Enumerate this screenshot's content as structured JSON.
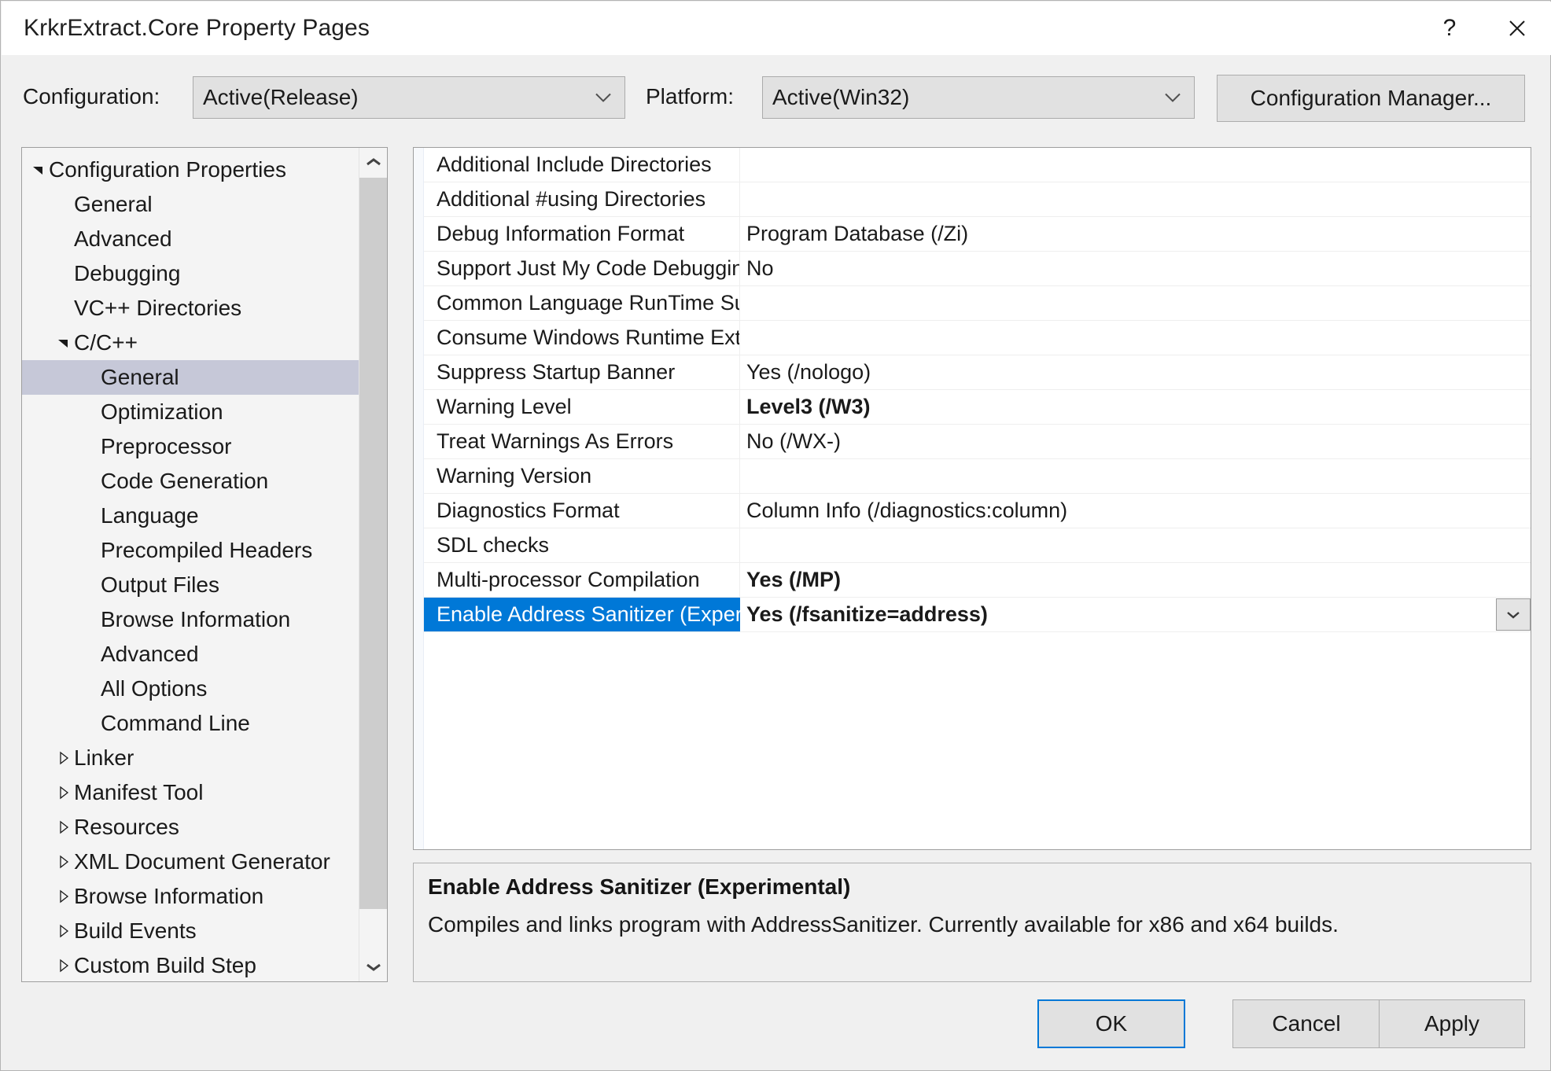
{
  "window": {
    "title": "KrkrExtract.Core Property Pages",
    "help_button": "?",
    "close_button": "✕",
    "help_icon": "question-mark-icon",
    "close_icon": "close-icon"
  },
  "toolbar": {
    "configuration_label": "Configuration:",
    "configuration_value": "Active(Release)",
    "platform_label": "Platform:",
    "platform_value": "Active(Win32)",
    "configuration_manager_label": "Configuration Manager..."
  },
  "tree": {
    "items": [
      {
        "label": "Configuration Properties",
        "depth": 1,
        "state": "expanded",
        "selected": false
      },
      {
        "label": "General",
        "depth": 2,
        "state": "leaf",
        "selected": false
      },
      {
        "label": "Advanced",
        "depth": 2,
        "state": "leaf",
        "selected": false
      },
      {
        "label": "Debugging",
        "depth": 2,
        "state": "leaf",
        "selected": false
      },
      {
        "label": "VC++ Directories",
        "depth": 2,
        "state": "leaf",
        "selected": false
      },
      {
        "label": "C/C++",
        "depth": 2,
        "state": "expanded",
        "selected": false
      },
      {
        "label": "General",
        "depth": 3,
        "state": "leaf",
        "selected": true
      },
      {
        "label": "Optimization",
        "depth": 3,
        "state": "leaf",
        "selected": false
      },
      {
        "label": "Preprocessor",
        "depth": 3,
        "state": "leaf",
        "selected": false
      },
      {
        "label": "Code Generation",
        "depth": 3,
        "state": "leaf",
        "selected": false
      },
      {
        "label": "Language",
        "depth": 3,
        "state": "leaf",
        "selected": false
      },
      {
        "label": "Precompiled Headers",
        "depth": 3,
        "state": "leaf",
        "selected": false
      },
      {
        "label": "Output Files",
        "depth": 3,
        "state": "leaf",
        "selected": false
      },
      {
        "label": "Browse Information",
        "depth": 3,
        "state": "leaf",
        "selected": false
      },
      {
        "label": "Advanced",
        "depth": 3,
        "state": "leaf",
        "selected": false
      },
      {
        "label": "All Options",
        "depth": 3,
        "state": "leaf",
        "selected": false
      },
      {
        "label": "Command Line",
        "depth": 3,
        "state": "leaf",
        "selected": false
      },
      {
        "label": "Linker",
        "depth": 2,
        "state": "collapsed",
        "selected": false
      },
      {
        "label": "Manifest Tool",
        "depth": 2,
        "state": "collapsed",
        "selected": false
      },
      {
        "label": "Resources",
        "depth": 2,
        "state": "collapsed",
        "selected": false
      },
      {
        "label": "XML Document Generator",
        "depth": 2,
        "state": "collapsed",
        "selected": false
      },
      {
        "label": "Browse Information",
        "depth": 2,
        "state": "collapsed",
        "selected": false
      },
      {
        "label": "Build Events",
        "depth": 2,
        "state": "collapsed",
        "selected": false
      },
      {
        "label": "Custom Build Step",
        "depth": 2,
        "state": "collapsed",
        "selected": false
      }
    ],
    "scrollbar": {
      "up_icon": "chevron-up-icon",
      "down_icon": "chevron-down-icon"
    }
  },
  "property_grid": {
    "rows": [
      {
        "name": "Additional Include Directories",
        "value": "",
        "modified": false,
        "selected": false
      },
      {
        "name": "Additional #using Directories",
        "value": "",
        "modified": false,
        "selected": false
      },
      {
        "name": "Debug Information Format",
        "value": "Program Database (/Zi)",
        "modified": false,
        "selected": false
      },
      {
        "name": "Support Just My Code Debugging",
        "value": "No",
        "modified": false,
        "selected": false
      },
      {
        "name": "Common Language RunTime Support",
        "value": "",
        "modified": false,
        "selected": false
      },
      {
        "name": "Consume Windows Runtime Extension",
        "value": "",
        "modified": false,
        "selected": false
      },
      {
        "name": "Suppress Startup Banner",
        "value": "Yes (/nologo)",
        "modified": false,
        "selected": false
      },
      {
        "name": "Warning Level",
        "value": "Level3 (/W3)",
        "modified": true,
        "selected": false
      },
      {
        "name": "Treat Warnings As Errors",
        "value": "No (/WX-)",
        "modified": false,
        "selected": false
      },
      {
        "name": "Warning Version",
        "value": "",
        "modified": false,
        "selected": false
      },
      {
        "name": "Diagnostics Format",
        "value": "Column Info (/diagnostics:column)",
        "modified": false,
        "selected": false
      },
      {
        "name": "SDL checks",
        "value": "",
        "modified": false,
        "selected": false
      },
      {
        "name": "Multi-processor Compilation",
        "value": "Yes (/MP)",
        "modified": true,
        "selected": false
      },
      {
        "name": "Enable Address Sanitizer (Experimental)",
        "value": "Yes (/fsanitize=address)",
        "modified": true,
        "selected": true
      }
    ],
    "dropdown_icon": "chevron-down-icon"
  },
  "description": {
    "title": "Enable Address Sanitizer (Experimental)",
    "body": "Compiles and links program with AddressSanitizer. Currently available for x86 and x64 builds."
  },
  "footer": {
    "ok_label": "OK",
    "cancel_label": "Cancel",
    "apply_label": "Apply"
  },
  "colors": {
    "selection_blue": "#0078d7",
    "tree_selection": "#c6c8d8",
    "dialog_background": "#f0f0f0",
    "control_face": "#e1e1e1"
  }
}
